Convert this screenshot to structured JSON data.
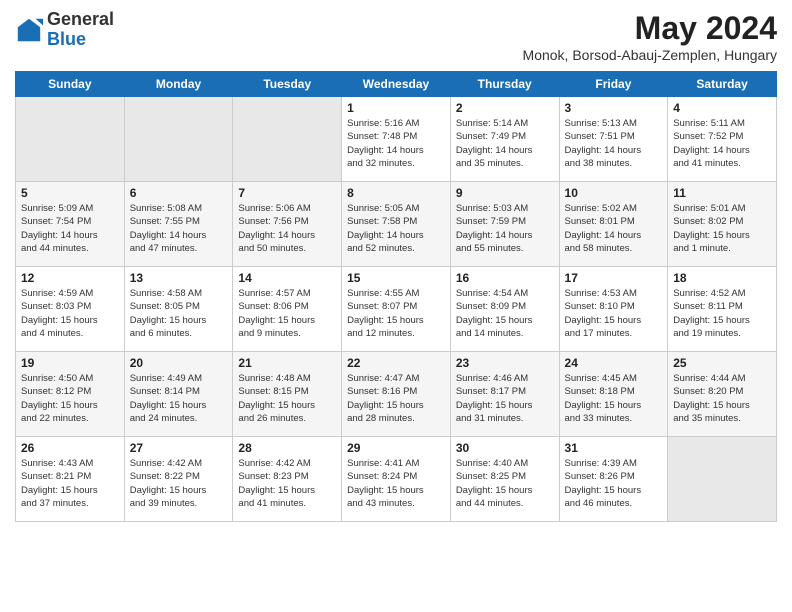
{
  "header": {
    "logo_general": "General",
    "logo_blue": "Blue",
    "month_year": "May 2024",
    "location": "Monok, Borsod-Abauj-Zemplen, Hungary"
  },
  "days_of_week": [
    "Sunday",
    "Monday",
    "Tuesday",
    "Wednesday",
    "Thursday",
    "Friday",
    "Saturday"
  ],
  "weeks": [
    [
      {
        "day": "",
        "info": ""
      },
      {
        "day": "",
        "info": ""
      },
      {
        "day": "",
        "info": ""
      },
      {
        "day": "1",
        "info": "Sunrise: 5:16 AM\nSunset: 7:48 PM\nDaylight: 14 hours\nand 32 minutes."
      },
      {
        "day": "2",
        "info": "Sunrise: 5:14 AM\nSunset: 7:49 PM\nDaylight: 14 hours\nand 35 minutes."
      },
      {
        "day": "3",
        "info": "Sunrise: 5:13 AM\nSunset: 7:51 PM\nDaylight: 14 hours\nand 38 minutes."
      },
      {
        "day": "4",
        "info": "Sunrise: 5:11 AM\nSunset: 7:52 PM\nDaylight: 14 hours\nand 41 minutes."
      }
    ],
    [
      {
        "day": "5",
        "info": "Sunrise: 5:09 AM\nSunset: 7:54 PM\nDaylight: 14 hours\nand 44 minutes."
      },
      {
        "day": "6",
        "info": "Sunrise: 5:08 AM\nSunset: 7:55 PM\nDaylight: 14 hours\nand 47 minutes."
      },
      {
        "day": "7",
        "info": "Sunrise: 5:06 AM\nSunset: 7:56 PM\nDaylight: 14 hours\nand 50 minutes."
      },
      {
        "day": "8",
        "info": "Sunrise: 5:05 AM\nSunset: 7:58 PM\nDaylight: 14 hours\nand 52 minutes."
      },
      {
        "day": "9",
        "info": "Sunrise: 5:03 AM\nSunset: 7:59 PM\nDaylight: 14 hours\nand 55 minutes."
      },
      {
        "day": "10",
        "info": "Sunrise: 5:02 AM\nSunset: 8:01 PM\nDaylight: 14 hours\nand 58 minutes."
      },
      {
        "day": "11",
        "info": "Sunrise: 5:01 AM\nSunset: 8:02 PM\nDaylight: 15 hours\nand 1 minute."
      }
    ],
    [
      {
        "day": "12",
        "info": "Sunrise: 4:59 AM\nSunset: 8:03 PM\nDaylight: 15 hours\nand 4 minutes."
      },
      {
        "day": "13",
        "info": "Sunrise: 4:58 AM\nSunset: 8:05 PM\nDaylight: 15 hours\nand 6 minutes."
      },
      {
        "day": "14",
        "info": "Sunrise: 4:57 AM\nSunset: 8:06 PM\nDaylight: 15 hours\nand 9 minutes."
      },
      {
        "day": "15",
        "info": "Sunrise: 4:55 AM\nSunset: 8:07 PM\nDaylight: 15 hours\nand 12 minutes."
      },
      {
        "day": "16",
        "info": "Sunrise: 4:54 AM\nSunset: 8:09 PM\nDaylight: 15 hours\nand 14 minutes."
      },
      {
        "day": "17",
        "info": "Sunrise: 4:53 AM\nSunset: 8:10 PM\nDaylight: 15 hours\nand 17 minutes."
      },
      {
        "day": "18",
        "info": "Sunrise: 4:52 AM\nSunset: 8:11 PM\nDaylight: 15 hours\nand 19 minutes."
      }
    ],
    [
      {
        "day": "19",
        "info": "Sunrise: 4:50 AM\nSunset: 8:12 PM\nDaylight: 15 hours\nand 22 minutes."
      },
      {
        "day": "20",
        "info": "Sunrise: 4:49 AM\nSunset: 8:14 PM\nDaylight: 15 hours\nand 24 minutes."
      },
      {
        "day": "21",
        "info": "Sunrise: 4:48 AM\nSunset: 8:15 PM\nDaylight: 15 hours\nand 26 minutes."
      },
      {
        "day": "22",
        "info": "Sunrise: 4:47 AM\nSunset: 8:16 PM\nDaylight: 15 hours\nand 28 minutes."
      },
      {
        "day": "23",
        "info": "Sunrise: 4:46 AM\nSunset: 8:17 PM\nDaylight: 15 hours\nand 31 minutes."
      },
      {
        "day": "24",
        "info": "Sunrise: 4:45 AM\nSunset: 8:18 PM\nDaylight: 15 hours\nand 33 minutes."
      },
      {
        "day": "25",
        "info": "Sunrise: 4:44 AM\nSunset: 8:20 PM\nDaylight: 15 hours\nand 35 minutes."
      }
    ],
    [
      {
        "day": "26",
        "info": "Sunrise: 4:43 AM\nSunset: 8:21 PM\nDaylight: 15 hours\nand 37 minutes."
      },
      {
        "day": "27",
        "info": "Sunrise: 4:42 AM\nSunset: 8:22 PM\nDaylight: 15 hours\nand 39 minutes."
      },
      {
        "day": "28",
        "info": "Sunrise: 4:42 AM\nSunset: 8:23 PM\nDaylight: 15 hours\nand 41 minutes."
      },
      {
        "day": "29",
        "info": "Sunrise: 4:41 AM\nSunset: 8:24 PM\nDaylight: 15 hours\nand 43 minutes."
      },
      {
        "day": "30",
        "info": "Sunrise: 4:40 AM\nSunset: 8:25 PM\nDaylight: 15 hours\nand 44 minutes."
      },
      {
        "day": "31",
        "info": "Sunrise: 4:39 AM\nSunset: 8:26 PM\nDaylight: 15 hours\nand 46 minutes."
      },
      {
        "day": "",
        "info": ""
      }
    ]
  ]
}
